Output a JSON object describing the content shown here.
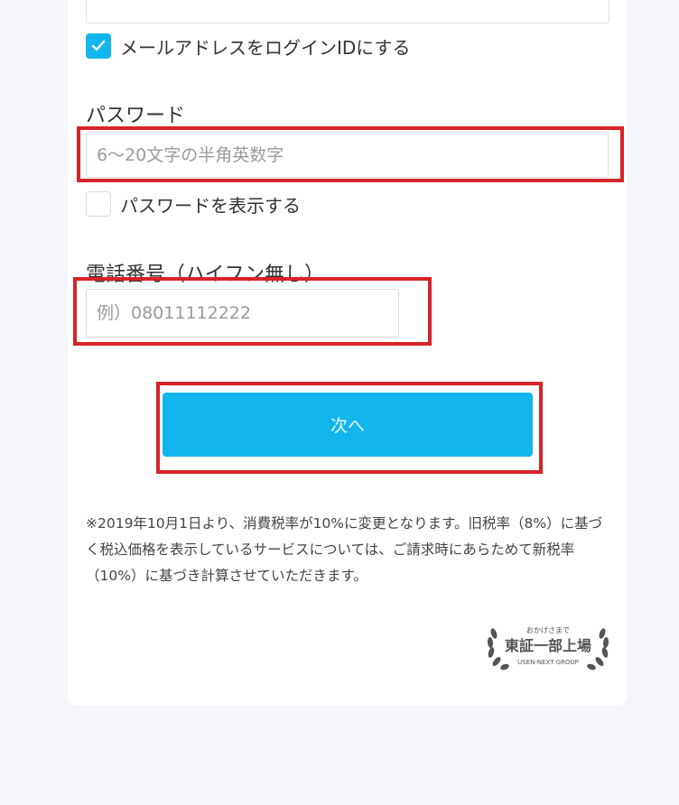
{
  "email_options": {
    "login_id_checkbox": {
      "checked": true,
      "label": "メールアドレスをログインIDにする"
    }
  },
  "password": {
    "label": "パスワード",
    "placeholder": "6～20文字の半角英数字",
    "value": "",
    "show_checkbox": {
      "checked": false,
      "label": "パスワードを表示する"
    }
  },
  "phone": {
    "label": "電話番号（ハイフン無し）",
    "placeholder": "例）08011112222",
    "value": ""
  },
  "next_button": {
    "label": "次へ"
  },
  "notice": "※2019年10月1日より、消費税率が10%に変更となります。旧税率（8%）に基づく税込価格を表示しているサービスについては、ご請求時にあらためて新税率（10%）に基づき計算させていただきます。",
  "badge": {
    "top_text": "おかげさまで",
    "main_text": "東証一部上場",
    "bottom_text": "USEN-NEXT GROUP"
  },
  "colors": {
    "accent": "#13b6ec",
    "highlight_box": "#d7232b",
    "page_background": "#f5f6f9"
  }
}
